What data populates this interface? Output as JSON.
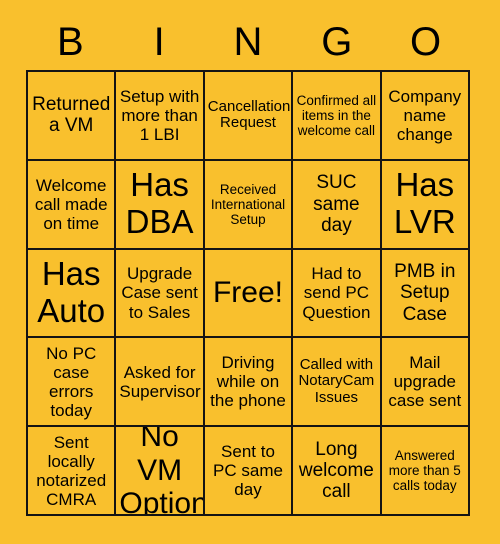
{
  "card": {
    "background_color": "#f9c02d",
    "grid_line_color": "#141414",
    "text_color": "#000000",
    "header": {
      "letters": [
        "B",
        "I",
        "N",
        "G",
        "O"
      ]
    },
    "rows": [
      [
        {
          "text": "Returned a VM",
          "size": "l"
        },
        {
          "text": "Setup with more than 1 LBI",
          "size": "m"
        },
        {
          "text": "Cancellation Request",
          "size": "s"
        },
        {
          "text": "Confirmed all items in the welcome call",
          "size": "xs"
        },
        {
          "text": "Company name change",
          "size": "m"
        }
      ],
      [
        {
          "text": "Welcome call made on time",
          "size": "m"
        },
        {
          "text": "Has DBA",
          "size": "xxl"
        },
        {
          "text": "Received International Setup",
          "size": "xs"
        },
        {
          "text": "SUC same day",
          "size": "l"
        },
        {
          "text": "Has LVR",
          "size": "xxl"
        }
      ],
      [
        {
          "text": "Has Auto",
          "size": "xxl"
        },
        {
          "text": "Upgrade Case sent to Sales",
          "size": "m"
        },
        {
          "text": "Free!",
          "size": "xl"
        },
        {
          "text": "Had to send PC Question",
          "size": "m"
        },
        {
          "text": "PMB in Setup Case",
          "size": "l"
        }
      ],
      [
        {
          "text": "No PC case errors today",
          "size": "m"
        },
        {
          "text": "Asked for Supervisor",
          "size": "m"
        },
        {
          "text": "Driving while on the phone",
          "size": "m"
        },
        {
          "text": "Called with NotaryCam Issues",
          "size": "s"
        },
        {
          "text": "Mail upgrade case sent",
          "size": "m"
        }
      ],
      [
        {
          "text": "Sent locally notarized CMRA",
          "size": "m"
        },
        {
          "text": "No VM Option",
          "size": "xl"
        },
        {
          "text": "Sent to PC same day",
          "size": "m"
        },
        {
          "text": "Long welcome call",
          "size": "l"
        },
        {
          "text": "Answered more than 5 calls today",
          "size": "xs"
        }
      ]
    ]
  }
}
